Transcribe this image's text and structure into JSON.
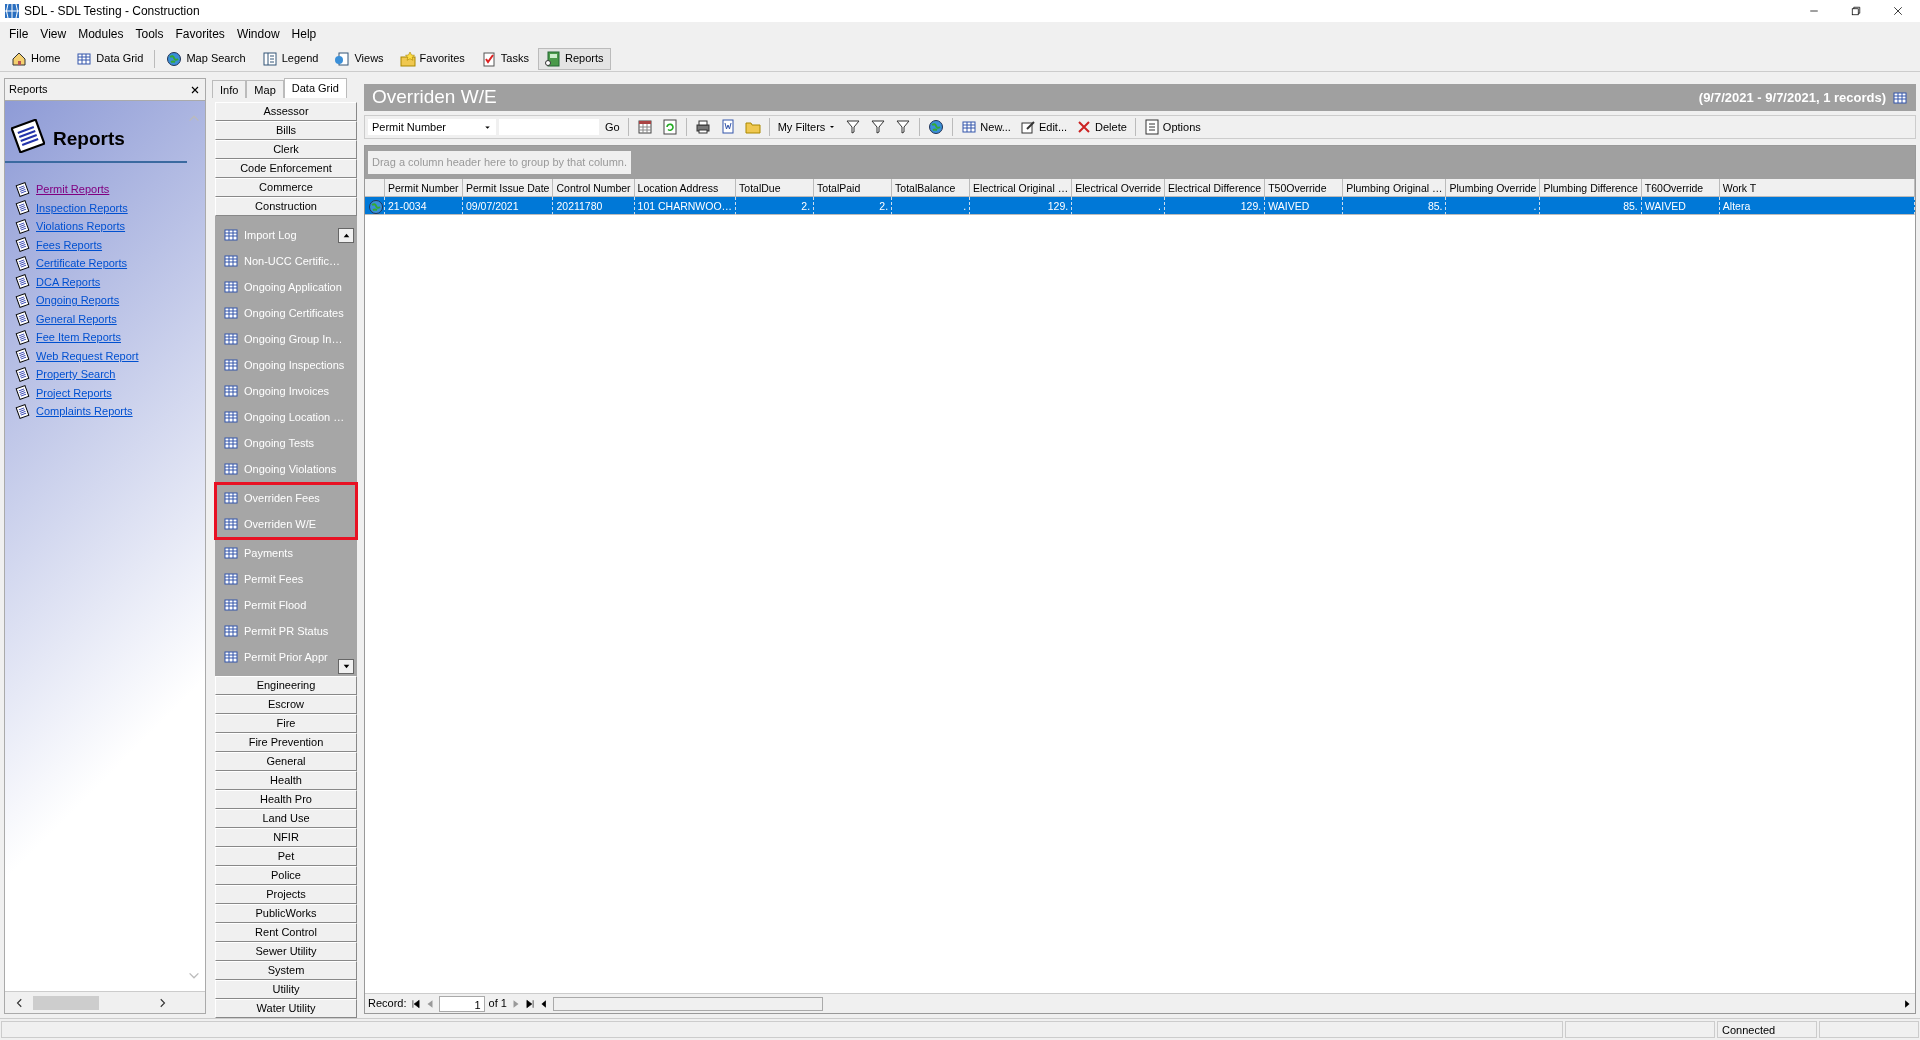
{
  "window": {
    "title": "SDL - SDL Testing - Construction"
  },
  "menu": [
    "File",
    "View",
    "Modules",
    "Tools",
    "Favorites",
    "Window",
    "Help"
  ],
  "toolbar": [
    {
      "label": "Home",
      "selected": false
    },
    {
      "label": "Data Grid",
      "selected": false
    },
    {
      "label": "Map Search",
      "selected": false
    },
    {
      "label": "Legend",
      "selected": false
    },
    {
      "label": "Views",
      "selected": false
    },
    {
      "label": "Favorites",
      "selected": false
    },
    {
      "label": "Tasks",
      "selected": false
    },
    {
      "label": "Reports",
      "selected": true
    }
  ],
  "reports_panel": {
    "title": "Reports",
    "heading": "Reports",
    "links": [
      {
        "label": "Permit Reports",
        "visited": true
      },
      {
        "label": "Inspection Reports",
        "visited": false
      },
      {
        "label": "Violations Reports",
        "visited": false
      },
      {
        "label": "Fees Reports",
        "visited": false
      },
      {
        "label": "Certificate Reports",
        "visited": false
      },
      {
        "label": "DCA Reports",
        "visited": false
      },
      {
        "label": "Ongoing Reports",
        "visited": false
      },
      {
        "label": "General Reports",
        "visited": false
      },
      {
        "label": "Fee Item Reports",
        "visited": false
      },
      {
        "label": "Web Request Report",
        "visited": false
      },
      {
        "label": "Property Search",
        "visited": false
      },
      {
        "label": "Project Reports",
        "visited": false
      },
      {
        "label": "Complaints Reports",
        "visited": false
      }
    ]
  },
  "tabs": [
    {
      "label": "Info",
      "selected": false
    },
    {
      "label": "Map",
      "selected": false
    },
    {
      "label": "Data Grid",
      "selected": true
    }
  ],
  "modules": [
    {
      "label": "Assessor"
    },
    {
      "label": "Bills"
    },
    {
      "label": "Clerk"
    },
    {
      "label": "Code Enforcement"
    },
    {
      "label": "Commerce"
    },
    {
      "label": "Construction",
      "items": [
        {
          "label": "Import Log",
          "highlighted": false
        },
        {
          "label": "Non-UCC Certific…",
          "highlighted": false
        },
        {
          "label": "Ongoing Application",
          "highlighted": false
        },
        {
          "label": "Ongoing Certificates",
          "highlighted": false
        },
        {
          "label": "Ongoing Group In…",
          "highlighted": false
        },
        {
          "label": "Ongoing Inspections",
          "highlighted": false
        },
        {
          "label": "Ongoing Invoices",
          "highlighted": false
        },
        {
          "label": "Ongoing Location …",
          "highlighted": false
        },
        {
          "label": "Ongoing Tests",
          "highlighted": false
        },
        {
          "label": "Ongoing Violations",
          "highlighted": false
        },
        {
          "label": "Overriden Fees",
          "highlighted": true
        },
        {
          "label": "Overriden W/E",
          "highlighted": true
        },
        {
          "label": "Payments",
          "highlighted": false
        },
        {
          "label": "Permit Fees",
          "highlighted": false
        },
        {
          "label": "Permit Flood",
          "highlighted": false
        },
        {
          "label": "Permit PR Status",
          "highlighted": false
        },
        {
          "label": "Permit Prior Appr",
          "highlighted": false
        }
      ]
    },
    {
      "label": "Engineering"
    },
    {
      "label": "Escrow"
    },
    {
      "label": "Fire"
    },
    {
      "label": "Fire Prevention"
    },
    {
      "label": "General"
    },
    {
      "label": "Health"
    },
    {
      "label": "Health Pro"
    },
    {
      "label": "Land Use"
    },
    {
      "label": "NFIR"
    },
    {
      "label": "Pet"
    },
    {
      "label": "Police"
    },
    {
      "label": "Projects"
    },
    {
      "label": "PublicWorks"
    },
    {
      "label": "Rent Control"
    },
    {
      "label": "Sewer Utility"
    },
    {
      "label": "System"
    },
    {
      "label": "Utility"
    },
    {
      "label": "Water Utility"
    }
  ],
  "grid": {
    "title": "Overriden W/E",
    "summary": "(9/7/2021 - 9/7/2021, 1 records)",
    "search_field": "Permit Number",
    "go": "Go",
    "tools": [
      {
        "kind": "menu",
        "label": "My Filters"
      },
      {
        "kind": "button",
        "label": "New..."
      },
      {
        "kind": "button",
        "label": "Edit..."
      },
      {
        "kind": "button",
        "label": "Delete"
      },
      {
        "kind": "button",
        "label": "Options"
      }
    ],
    "group_hint": "Drag a column header here to group by that column.",
    "columns": [
      {
        "label": "Permit Number",
        "kind": "text"
      },
      {
        "label": "Permit Issue Date",
        "kind": "text"
      },
      {
        "label": "Control Number",
        "kind": "text"
      },
      {
        "label": "Location Address",
        "kind": "text"
      },
      {
        "label": "TotalDue",
        "kind": "number"
      },
      {
        "label": "TotalPaid",
        "kind": "number"
      },
      {
        "label": "TotalBalance",
        "kind": "number"
      },
      {
        "label": "Electrical Original …",
        "kind": "number"
      },
      {
        "label": "Electrical Override",
        "kind": "number"
      },
      {
        "label": "Electrical Difference",
        "kind": "number"
      },
      {
        "label": "T50Override",
        "kind": "text"
      },
      {
        "label": "Plumbing Original …",
        "kind": "number"
      },
      {
        "label": "Plumbing Override",
        "kind": "number"
      },
      {
        "label": "Plumbing Difference",
        "kind": "number"
      },
      {
        "label": "T60Override",
        "kind": "text"
      },
      {
        "label": "Work T",
        "kind": "text"
      }
    ],
    "rows": [
      {
        "selected": true,
        "cells": [
          "21-0034",
          "09/07/2021",
          "20211780",
          "101 CHARNWOO…",
          "2.",
          "2.",
          ".",
          "129.",
          ".",
          "129.",
          "WAIVED",
          "85.",
          ".",
          "85.",
          "WAIVED",
          "Altera"
        ]
      }
    ],
    "record_label": "Record:",
    "record": "1",
    "record_of": "of 1"
  },
  "status_bar": {
    "connection": "Connected"
  }
}
